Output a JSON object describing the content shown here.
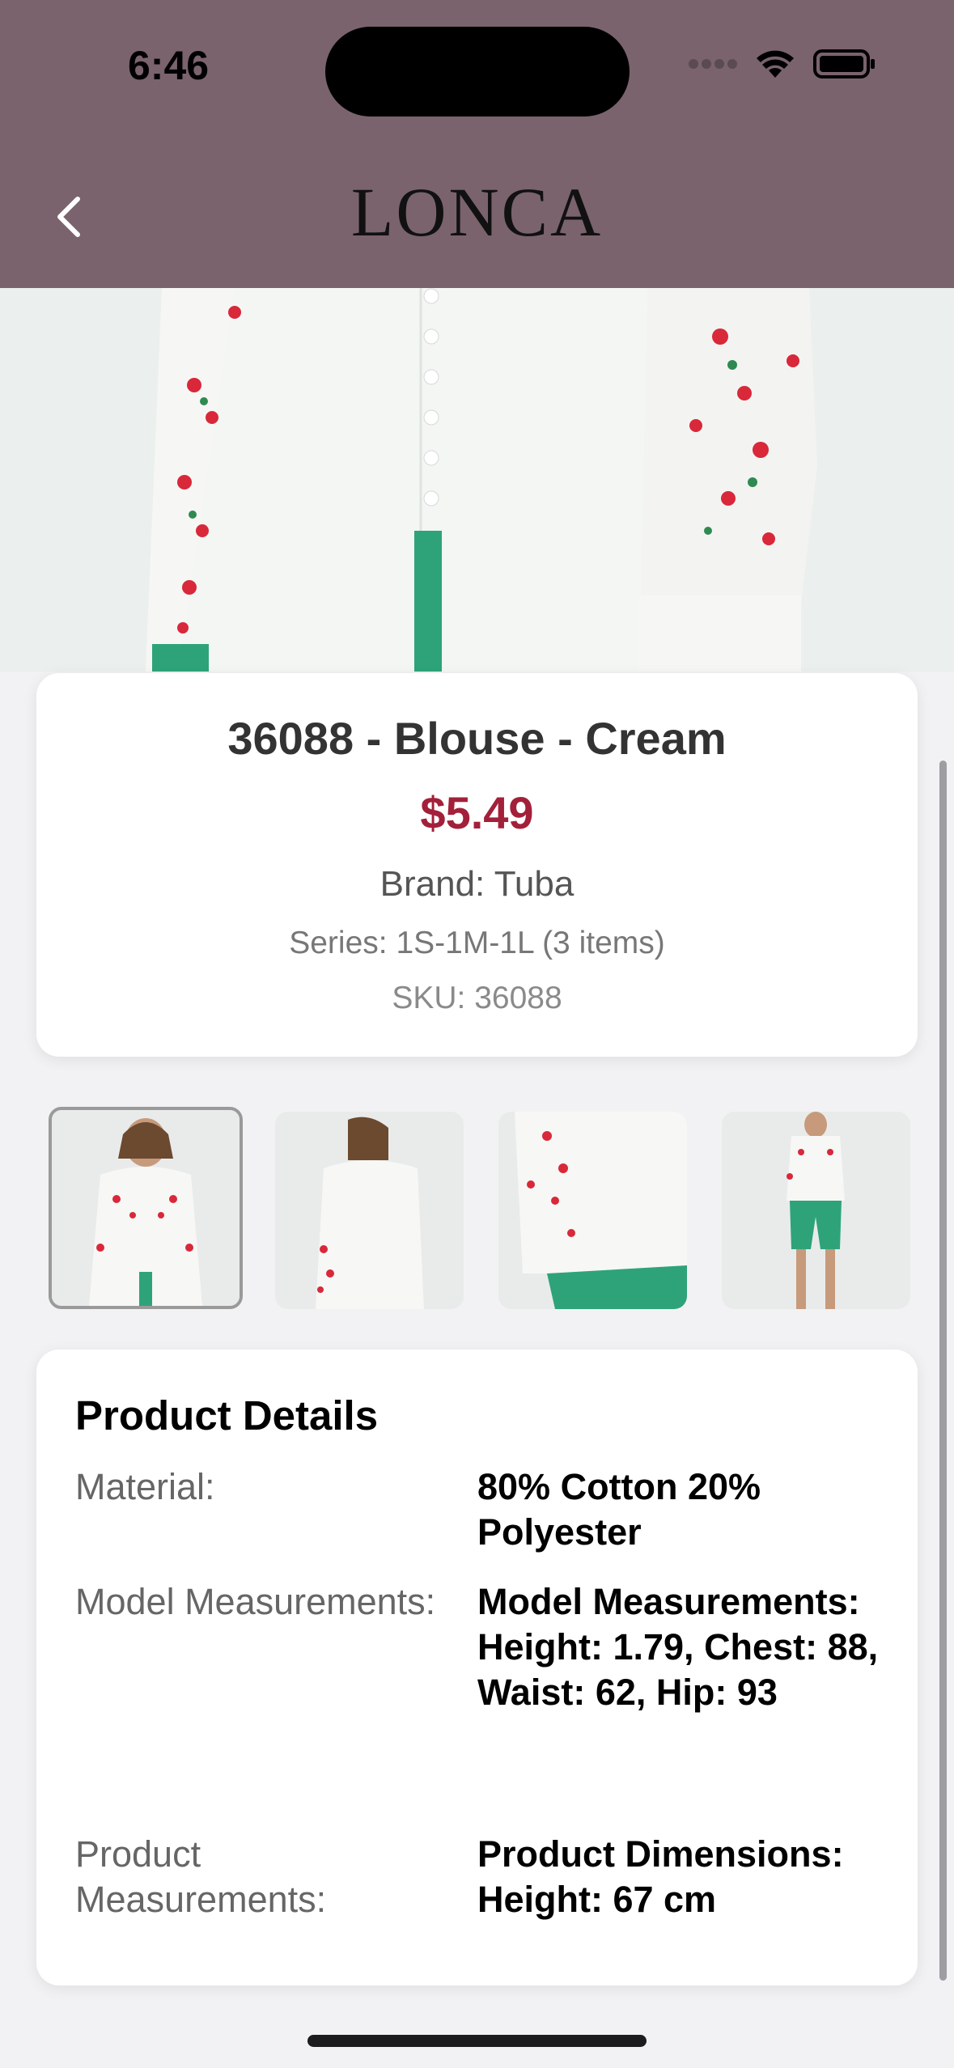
{
  "status_bar": {
    "time": "6:46"
  },
  "header": {
    "logo": "LONCA"
  },
  "product": {
    "title": "36088 - Blouse - Cream",
    "price": "$5.49",
    "brand": "Brand: Tuba",
    "series": "Series: 1S-1M-1L (3 items)",
    "sku": "SKU: 36088"
  },
  "thumbnails": {
    "count": 4,
    "selected_index": 0
  },
  "details": {
    "title": "Product Details",
    "rows": [
      {
        "label": "Material:",
        "value": "80% Cotton 20% Polyester"
      },
      {
        "label": "Model Measurements:",
        "value": "Model Measurements: Height: 1.79, Chest: 88, Waist: 62, Hip: 93"
      },
      {
        "label": "Product Measurements:",
        "value": "Product Dimensions: Height: 67 cm"
      }
    ]
  },
  "colors": {
    "header_bg": "#7a636d",
    "price": "#a3203a",
    "page_bg": "#f2f2f4"
  }
}
